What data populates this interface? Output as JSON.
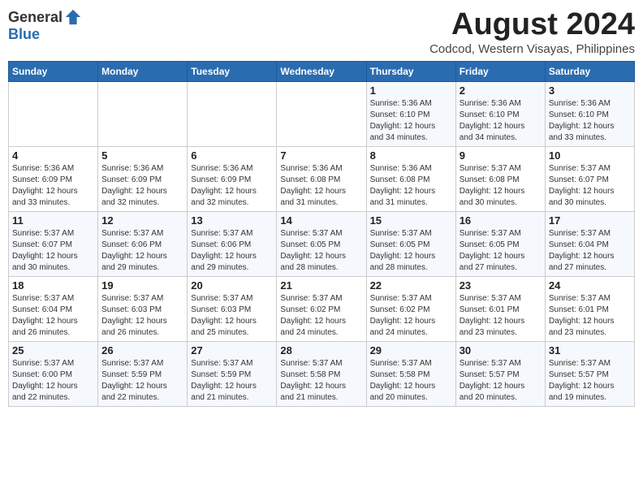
{
  "logo": {
    "general": "General",
    "blue": "Blue"
  },
  "title": "August 2024",
  "location": "Codcod, Western Visayas, Philippines",
  "days_of_week": [
    "Sunday",
    "Monday",
    "Tuesday",
    "Wednesday",
    "Thursday",
    "Friday",
    "Saturday"
  ],
  "weeks": [
    [
      {
        "day": "",
        "info": ""
      },
      {
        "day": "",
        "info": ""
      },
      {
        "day": "",
        "info": ""
      },
      {
        "day": "",
        "info": ""
      },
      {
        "day": "1",
        "info": "Sunrise: 5:36 AM\nSunset: 6:10 PM\nDaylight: 12 hours\nand 34 minutes."
      },
      {
        "day": "2",
        "info": "Sunrise: 5:36 AM\nSunset: 6:10 PM\nDaylight: 12 hours\nand 34 minutes."
      },
      {
        "day": "3",
        "info": "Sunrise: 5:36 AM\nSunset: 6:10 PM\nDaylight: 12 hours\nand 33 minutes."
      }
    ],
    [
      {
        "day": "4",
        "info": "Sunrise: 5:36 AM\nSunset: 6:09 PM\nDaylight: 12 hours\nand 33 minutes."
      },
      {
        "day": "5",
        "info": "Sunrise: 5:36 AM\nSunset: 6:09 PM\nDaylight: 12 hours\nand 32 minutes."
      },
      {
        "day": "6",
        "info": "Sunrise: 5:36 AM\nSunset: 6:09 PM\nDaylight: 12 hours\nand 32 minutes."
      },
      {
        "day": "7",
        "info": "Sunrise: 5:36 AM\nSunset: 6:08 PM\nDaylight: 12 hours\nand 31 minutes."
      },
      {
        "day": "8",
        "info": "Sunrise: 5:36 AM\nSunset: 6:08 PM\nDaylight: 12 hours\nand 31 minutes."
      },
      {
        "day": "9",
        "info": "Sunrise: 5:37 AM\nSunset: 6:08 PM\nDaylight: 12 hours\nand 30 minutes."
      },
      {
        "day": "10",
        "info": "Sunrise: 5:37 AM\nSunset: 6:07 PM\nDaylight: 12 hours\nand 30 minutes."
      }
    ],
    [
      {
        "day": "11",
        "info": "Sunrise: 5:37 AM\nSunset: 6:07 PM\nDaylight: 12 hours\nand 30 minutes."
      },
      {
        "day": "12",
        "info": "Sunrise: 5:37 AM\nSunset: 6:06 PM\nDaylight: 12 hours\nand 29 minutes."
      },
      {
        "day": "13",
        "info": "Sunrise: 5:37 AM\nSunset: 6:06 PM\nDaylight: 12 hours\nand 29 minutes."
      },
      {
        "day": "14",
        "info": "Sunrise: 5:37 AM\nSunset: 6:05 PM\nDaylight: 12 hours\nand 28 minutes."
      },
      {
        "day": "15",
        "info": "Sunrise: 5:37 AM\nSunset: 6:05 PM\nDaylight: 12 hours\nand 28 minutes."
      },
      {
        "day": "16",
        "info": "Sunrise: 5:37 AM\nSunset: 6:05 PM\nDaylight: 12 hours\nand 27 minutes."
      },
      {
        "day": "17",
        "info": "Sunrise: 5:37 AM\nSunset: 6:04 PM\nDaylight: 12 hours\nand 27 minutes."
      }
    ],
    [
      {
        "day": "18",
        "info": "Sunrise: 5:37 AM\nSunset: 6:04 PM\nDaylight: 12 hours\nand 26 minutes."
      },
      {
        "day": "19",
        "info": "Sunrise: 5:37 AM\nSunset: 6:03 PM\nDaylight: 12 hours\nand 26 minutes."
      },
      {
        "day": "20",
        "info": "Sunrise: 5:37 AM\nSunset: 6:03 PM\nDaylight: 12 hours\nand 25 minutes."
      },
      {
        "day": "21",
        "info": "Sunrise: 5:37 AM\nSunset: 6:02 PM\nDaylight: 12 hours\nand 24 minutes."
      },
      {
        "day": "22",
        "info": "Sunrise: 5:37 AM\nSunset: 6:02 PM\nDaylight: 12 hours\nand 24 minutes."
      },
      {
        "day": "23",
        "info": "Sunrise: 5:37 AM\nSunset: 6:01 PM\nDaylight: 12 hours\nand 23 minutes."
      },
      {
        "day": "24",
        "info": "Sunrise: 5:37 AM\nSunset: 6:01 PM\nDaylight: 12 hours\nand 23 minutes."
      }
    ],
    [
      {
        "day": "25",
        "info": "Sunrise: 5:37 AM\nSunset: 6:00 PM\nDaylight: 12 hours\nand 22 minutes."
      },
      {
        "day": "26",
        "info": "Sunrise: 5:37 AM\nSunset: 5:59 PM\nDaylight: 12 hours\nand 22 minutes."
      },
      {
        "day": "27",
        "info": "Sunrise: 5:37 AM\nSunset: 5:59 PM\nDaylight: 12 hours\nand 21 minutes."
      },
      {
        "day": "28",
        "info": "Sunrise: 5:37 AM\nSunset: 5:58 PM\nDaylight: 12 hours\nand 21 minutes."
      },
      {
        "day": "29",
        "info": "Sunrise: 5:37 AM\nSunset: 5:58 PM\nDaylight: 12 hours\nand 20 minutes."
      },
      {
        "day": "30",
        "info": "Sunrise: 5:37 AM\nSunset: 5:57 PM\nDaylight: 12 hours\nand 20 minutes."
      },
      {
        "day": "31",
        "info": "Sunrise: 5:37 AM\nSunset: 5:57 PM\nDaylight: 12 hours\nand 19 minutes."
      }
    ]
  ]
}
